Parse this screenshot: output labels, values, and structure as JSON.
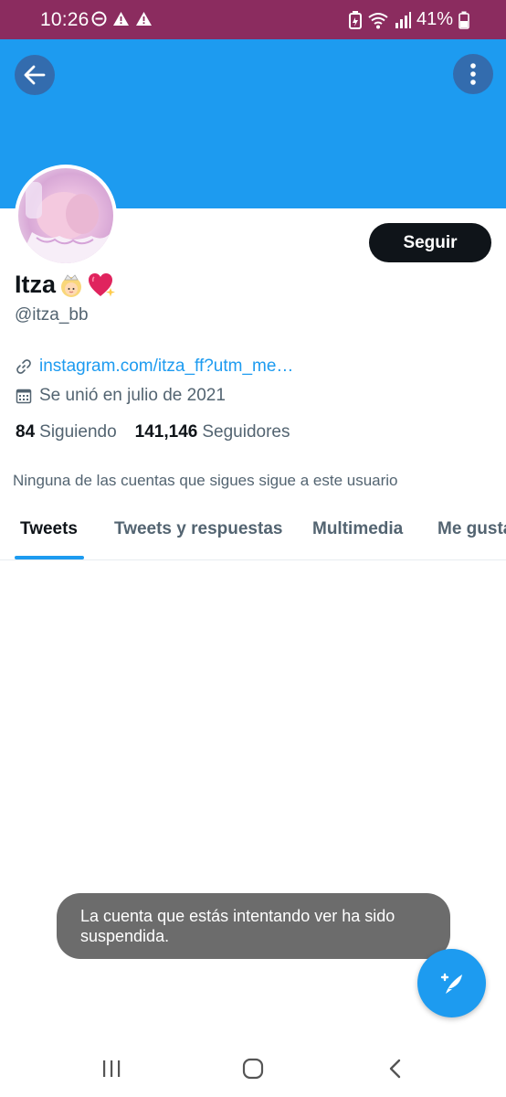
{
  "status_bar": {
    "time": "10:26",
    "battery": "41%",
    "bar_color": "#8b2c5f"
  },
  "header": {
    "banner_color": "#1d9bf0",
    "back_icon": "arrow-left-icon",
    "more_icon": "more-vertical-icon"
  },
  "profile": {
    "display_name": "Itza",
    "name_emojis": [
      "princess-emoji",
      "sparkling-heart-emoji"
    ],
    "handle": "@itza_bb",
    "link": "instagram.com/itza_ff?utm_me…",
    "joined": "Se unió en julio de 2021",
    "following_count": "84",
    "following_label": "Siguiendo",
    "followers_count": "141,146",
    "followers_label": "Seguidores",
    "mutual_note": "Ninguna de las cuentas que sigues sigue a este usuario",
    "follow_button": "Seguir"
  },
  "tabs": [
    "Tweets",
    "Tweets y respuestas",
    "Multimedia",
    "Me gusta"
  ],
  "active_tab": 0,
  "toast": "La cuenta que estás intentando ver ha sido suspendida.",
  "fab": {
    "icon": "compose-tweet-icon",
    "color": "#1d9bf0"
  },
  "nav_bar": {
    "recents_icon": "recents-icon",
    "home_icon": "home-icon",
    "back_icon": "nav-back-icon"
  }
}
